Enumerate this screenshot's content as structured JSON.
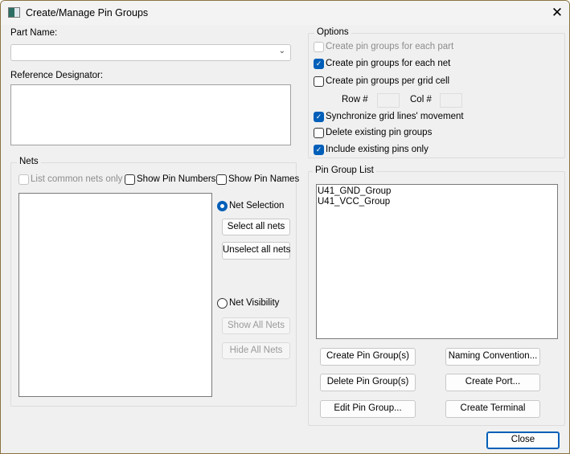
{
  "window": {
    "title": "Create/Manage Pin Groups"
  },
  "part_name": {
    "label": "Part Name:",
    "value": ""
  },
  "ref_des": {
    "label": "Reference Designator:",
    "value": ""
  },
  "nets": {
    "legend": "Nets",
    "list_common": {
      "label": "List common nets only",
      "checked": false,
      "disabled": true
    },
    "show_pin_numbers": {
      "label": "Show Pin Numbers",
      "checked": false
    },
    "show_pin_names": {
      "label": "Show Pin Names",
      "checked": false
    },
    "net_selection": {
      "label": "Net Selection",
      "selected": true
    },
    "select_all": "Select all nets",
    "unselect_all": "Unselect all nets",
    "net_visibility": {
      "label": "Net Visibility",
      "selected": false
    },
    "show_all": "Show All Nets",
    "hide_all": "Hide All Nets"
  },
  "options": {
    "legend": "Options",
    "items": [
      {
        "label": "Create pin groups for each part",
        "checked": false,
        "disabled": true
      },
      {
        "label": "Create pin groups for each net",
        "checked": true
      },
      {
        "label": "Create pin groups per grid cell",
        "checked": false
      },
      {
        "label": "Synchronize grid lines' movement",
        "checked": true
      },
      {
        "label": "Delete existing pin groups",
        "checked": false
      },
      {
        "label": "Include existing pins only",
        "checked": true
      }
    ],
    "row_label": "Row #",
    "row_value": "",
    "col_label": "Col #",
    "col_value": ""
  },
  "pin_group_list": {
    "legend": "Pin Group List",
    "items": [
      "U41_GND_Group",
      "U41_VCC_Group"
    ],
    "buttons": {
      "create": "Create Pin Group(s)",
      "naming": "Naming Convention...",
      "delete": "Delete Pin Group(s)",
      "create_port": "Create Port...",
      "edit": "Edit Pin Group...",
      "create_terminal": "Create Terminal"
    }
  },
  "close": "Close"
}
